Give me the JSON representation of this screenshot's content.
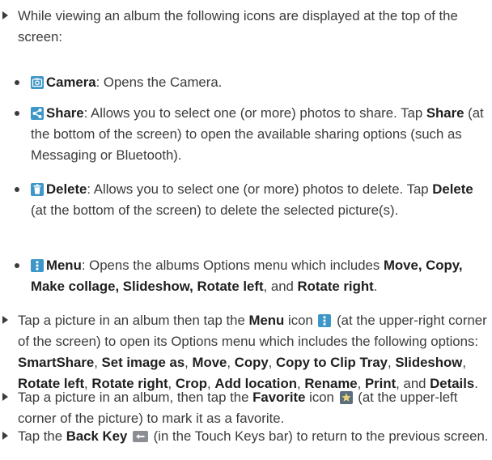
{
  "p1": {
    "text": "While viewing an album the following icons are displayed at the top of the screen:"
  },
  "camera": {
    "icon": "camera-icon",
    "label": "Camera",
    "desc": ": Opens the Camera."
  },
  "share": {
    "icon": "share-icon",
    "label": "Share",
    "t1": ": Allows you to select one (or more) photos to share. Tap ",
    "b1": "Share",
    "t2": " (at the bottom of the screen) to open the available sharing options (such as Messaging or Bluetooth)."
  },
  "delete": {
    "icon": "trash-icon",
    "label": "Delete",
    "t1": ": Allows you to select one (or more) photos to delete. Tap ",
    "b1": "Delete",
    "t2": " (at the bottom of the screen) to delete the selected picture(s)."
  },
  "menu": {
    "icon": "menu-icon",
    "label": "Menu",
    "t1": ": Opens the albums Options menu which includes ",
    "b1": "Move, Copy, Make collage, Slideshow, Rotate left",
    "t2": ", and ",
    "b2": "Rotate right",
    "t3": "."
  },
  "p2": {
    "t1": "Tap a picture in an album then tap the ",
    "b1": "Menu",
    "t2": " icon ",
    "icon": "menu-icon",
    "t3": " (at the upper-right corner of the screen) to open its Options menu which includes the following options: ",
    "b2": "SmartShare",
    "s1": ", ",
    "b3": "Set image as",
    "s2": ", ",
    "b4": "Move",
    "s3": ", ",
    "b5": "Copy",
    "s4": ", ",
    "b6": "Copy to Clip Tray",
    "s5": ", ",
    "b7": "Slideshow",
    "s6": ", ",
    "b8": "Rotate left",
    "s7": ", ",
    "b9": "Rotate right",
    "s8": ", ",
    "b10": "Crop",
    "s9": ", ",
    "b11": "Add location",
    "s10": ", ",
    "b12": "Rename",
    "s11": ", ",
    "b13": "Print",
    "s12": ", and ",
    "b14": "Details",
    "s13": "."
  },
  "p3": {
    "t1": "Tap a picture in an album, then tap the ",
    "b1": "Favorite",
    "t2": " icon ",
    "icon": "star-icon",
    "t3": " (at the upper-left corner of the picture) to mark it as a favorite."
  },
  "p4": {
    "t1": "Tap the ",
    "b1": "Back Key",
    "t2": " ",
    "icon": "back-icon",
    "t3": " (in the Touch Keys bar) to return to the previous screen."
  }
}
